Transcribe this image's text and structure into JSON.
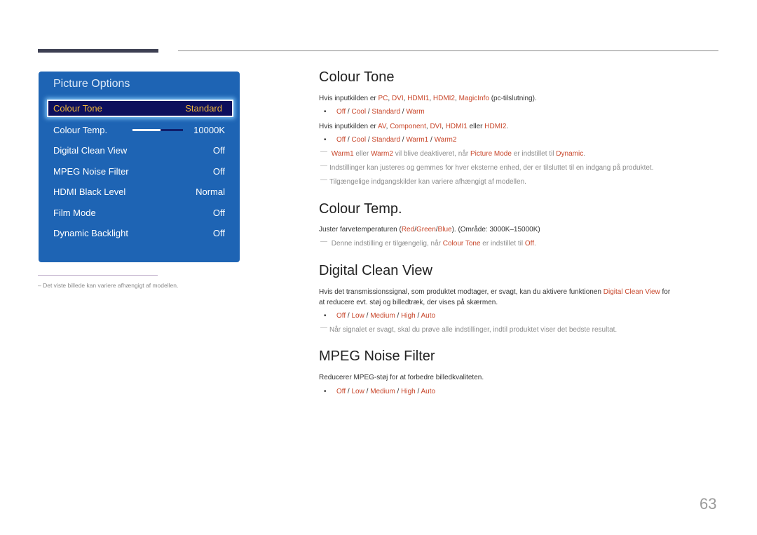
{
  "page_number": "63",
  "osd": {
    "title": "Picture Options",
    "rows": [
      {
        "label": "Colour Tone",
        "value": "Standard",
        "selected": true
      },
      {
        "label": "Colour Temp.",
        "value": "10000K",
        "slider_fraction": 0.55
      },
      {
        "label": "Digital Clean View",
        "value": "Off"
      },
      {
        "label": "MPEG Noise Filter",
        "value": "Off"
      },
      {
        "label": "HDMI Black Level",
        "value": "Normal"
      },
      {
        "label": "Film Mode",
        "value": "Off"
      },
      {
        "label": "Dynamic Backlight",
        "value": "Off"
      }
    ]
  },
  "footnote": "–  Det viste billede kan variere afhængigt af modellen.",
  "sections": {
    "colour_tone": {
      "heading": "Colour Tone",
      "line1": {
        "prefix": "Hvis inputkilden er ",
        "items": [
          "PC",
          "DVI",
          "HDMI1",
          "HDMI2",
          "MagicInfo"
        ],
        "suffix": " (pc-tilslutning)."
      },
      "options1": [
        "Off",
        "Cool",
        "Standard",
        "Warm"
      ],
      "line2": {
        "prefix": "Hvis inputkilden er ",
        "items": [
          "AV",
          "Component",
          "DVI",
          "HDMI1"
        ],
        "conj": " eller ",
        "last": "HDMI2",
        "suffix": "."
      },
      "options2": [
        "Off",
        "Cool",
        "Standard",
        "Warm1",
        "Warm2"
      ],
      "note1": {
        "a": "Warm1",
        "b": " eller ",
        "c": "Warm2",
        "d": " vil blive deaktiveret, når ",
        "e": "Picture Mode",
        "f": " er indstillet til ",
        "g": "Dynamic",
        "h": "."
      },
      "note2": "Indstillinger kan justeres og gemmes for hver eksterne enhed, der er tilsluttet til en indgang på produktet.",
      "note3": "Tilgængelige indgangskilder kan variere afhængigt af modellen."
    },
    "colour_temp": {
      "heading": "Colour Temp.",
      "text": {
        "a": "Juster farvetemperaturen (",
        "r": "Red",
        "g": "Green",
        "b": "Blue",
        "z": "). (Område: 3000K–15000K)"
      },
      "note": {
        "a": "Denne indstilling er tilgængelig, når ",
        "b": "Colour Tone",
        "c": " er indstillet til ",
        "d": "Off",
        "e": "."
      }
    },
    "digital_clean_view": {
      "heading": "Digital Clean View",
      "text1a": "Hvis det transmissionssignal, som produktet modtager, er svagt, kan du aktivere funktionen ",
      "text1b": "Digital Clean View",
      "text1c": " for",
      "text2": "at reducere evt. støj og billedtræk, der vises på skærmen.",
      "options": [
        "Off",
        "Low",
        "Medium",
        "High",
        "Auto"
      ],
      "note": "Når signalet er svagt, skal du prøve alle indstillinger, indtil produktet viser det bedste resultat."
    },
    "mpeg_noise_filter": {
      "heading": "MPEG Noise Filter",
      "text": "Reducerer MPEG-støj for at forbedre billedkvaliteten.",
      "options": [
        "Off",
        "Low",
        "Medium",
        "High",
        "Auto"
      ]
    }
  },
  "colors": {
    "accent": "#c8462a",
    "osd_bg": "#1e64b4",
    "osd_selected": "#f2b73a"
  }
}
